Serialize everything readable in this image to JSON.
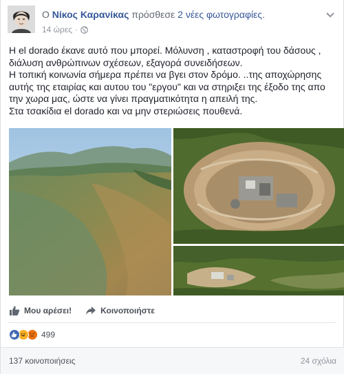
{
  "header": {
    "prefix": "Ο",
    "author": "Νίκος Καρανίκας",
    "action": "πρόσθεσε",
    "photos_link": "2 νέες φωτογραφίες",
    "suffix": ".",
    "time": "14 ώρες",
    "separator": "·"
  },
  "post": {
    "lines": [
      "Η el dorado έκανε αυτό που μπορεί. Μόλυνση , καταστροφή του δάσους , διάλυση ανθρώπινων σχέσεων, εξαγορά συνειδήσεων.",
      "Η τοπική κοινωνία σήμερα πρέπει να βγει στον δρόμο. ..της αποχώρησης αυτής της εταιρίας και αυτου του \"εργου\" και να στηριξει της έξοδο της απο την χωρα μας, ώστε να γίνει πραγματικότητα η απειλή της.",
      "Στα τσακίδια el dorado και να μην στεριώσεις πουθενά."
    ]
  },
  "actions": {
    "like_label": "Μου αρέσει!",
    "share_label": "Κοινοποιήστε"
  },
  "reactions": {
    "count": "499",
    "colors": {
      "like": "#4267b2",
      "haha": "#f7b125",
      "angry": "#e9710f"
    }
  },
  "footer": {
    "shares": "137 κοινοποιήσεις",
    "comments": "24 σχόλια"
  },
  "icons": {
    "globe": "globe-icon",
    "chevron": "chevron-down-icon",
    "like": "thumbs-up-icon",
    "share": "share-arrow-icon"
  },
  "colors": {
    "link": "#365899",
    "meta": "#90949c",
    "text": "#1d2129"
  }
}
